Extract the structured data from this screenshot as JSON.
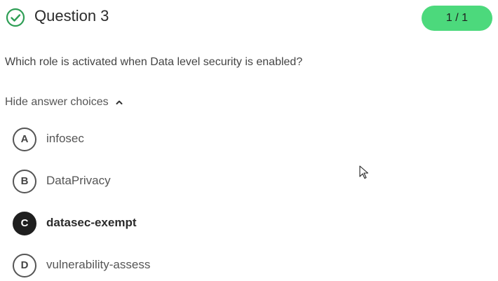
{
  "header": {
    "title": "Question 3",
    "score": "1 / 1",
    "status_icon": "check-circle-icon",
    "accent_color": "#2e9e55",
    "badge_color": "#4cd97c"
  },
  "question": {
    "text": "Which role is activated when Data level security is enabled?"
  },
  "toggle": {
    "label": "Hide answer choices",
    "icon": "chevron-up-icon"
  },
  "choices": [
    {
      "letter": "A",
      "text": "infosec",
      "selected": false
    },
    {
      "letter": "B",
      "text": "DataPrivacy",
      "selected": false
    },
    {
      "letter": "C",
      "text": "datasec-exempt",
      "selected": true
    },
    {
      "letter": "D",
      "text": "vulnerability-assess",
      "selected": false
    }
  ],
  "cursor_icon": "mouse-pointer-icon"
}
